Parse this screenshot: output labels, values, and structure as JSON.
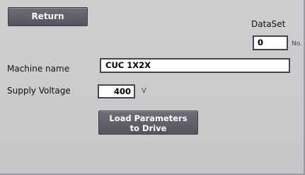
{
  "buttons": {
    "return_label": "Return",
    "load_params_label": "Load Parameters\nto Drive"
  },
  "dataset": {
    "label": "DataSet",
    "value": "0",
    "suffix": "No."
  },
  "machine": {
    "label": "Machine name",
    "value": "CUC 1X2X"
  },
  "supply_voltage": {
    "label": "Supply Voltage",
    "value": "400",
    "unit": "V"
  }
}
